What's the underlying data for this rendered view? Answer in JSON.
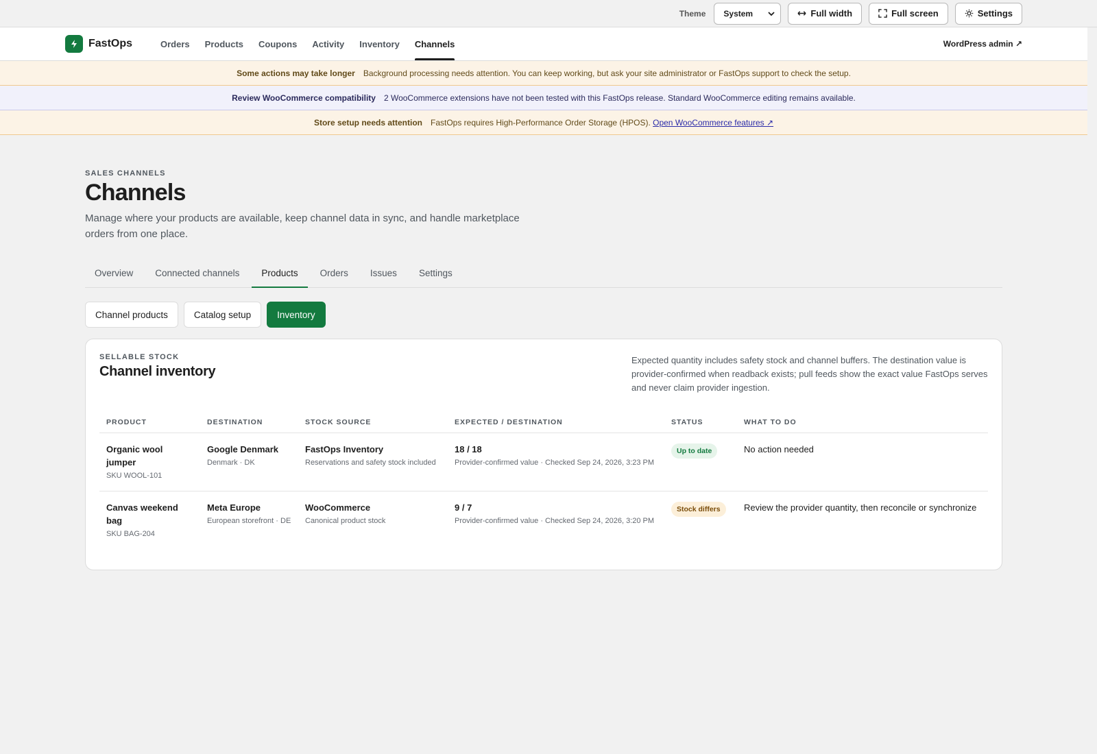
{
  "utilbar": {
    "theme_label": "Theme",
    "theme_value": "System",
    "full_width": "Full width",
    "full_screen": "Full screen",
    "settings": "Settings"
  },
  "nav": {
    "brand": "FastOps",
    "links": [
      "Orders",
      "Products",
      "Coupons",
      "Activity",
      "Inventory",
      "Channels"
    ],
    "active": "Channels",
    "wp_admin": "WordPress admin ↗"
  },
  "banners": [
    {
      "title": "Some actions may take longer",
      "text": "Background processing needs attention. You can keep working, but ask your site administrator or FastOps support to check the setup."
    },
    {
      "title": "Review WooCommerce compatibility",
      "text": "2 WooCommerce extensions have not been tested with this FastOps release. Standard WooCommerce editing remains available."
    },
    {
      "title": "Store setup needs attention",
      "text": "FastOps requires High-Performance Order Storage (HPOS).",
      "link": "Open WooCommerce features ↗"
    }
  ],
  "page": {
    "eyebrow": "SALES CHANNELS",
    "title": "Channels",
    "description": "Manage where your products are available, keep channel data in sync, and handle marketplace orders from one place."
  },
  "tabs": [
    "Overview",
    "Connected channels",
    "Products",
    "Orders",
    "Issues",
    "Settings"
  ],
  "subtabs": [
    "Channel products",
    "Catalog setup",
    "Inventory"
  ],
  "card": {
    "eyebrow": "SELLABLE STOCK",
    "title": "Channel inventory",
    "note": "Expected quantity includes safety stock and channel buffers. The destination value is provider-confirmed when readback exists; pull feeds show the exact value FastOps serves and never claim provider ingestion."
  },
  "table": {
    "headers": [
      "PRODUCT",
      "DESTINATION",
      "STOCK SOURCE",
      "EXPECTED / DESTINATION",
      "STATUS",
      "WHAT TO DO"
    ],
    "rows": [
      {
        "product": "Organic wool jumper",
        "sku": "SKU WOOL-101",
        "destination": "Google Denmark",
        "dest_sub": "Denmark · DK",
        "source": "FastOps Inventory",
        "source_sub": "Reservations and safety stock included",
        "expected": "18 / 18",
        "expected_sub": "Provider-confirmed value · Checked Sep 24, 2026, 3:23 PM",
        "status": "Up to date",
        "status_kind": "ok",
        "todo": "No action needed"
      },
      {
        "product": "Canvas weekend bag",
        "sku": "SKU BAG-204",
        "destination": "Meta Europe",
        "dest_sub": "European storefront · DE",
        "source": "WooCommerce",
        "source_sub": "Canonical product stock",
        "expected": "9 / 7",
        "expected_sub": "Provider-confirmed value · Checked Sep 24, 2026, 3:20 PM",
        "status": "Stock differs",
        "status_kind": "warn",
        "todo": "Review the provider quantity, then reconcile or synchronize"
      }
    ]
  },
  "colors": {
    "accent": "#137a3f",
    "warn_banner": "#fcf3e6",
    "info_banner": "#f1f1fb"
  }
}
